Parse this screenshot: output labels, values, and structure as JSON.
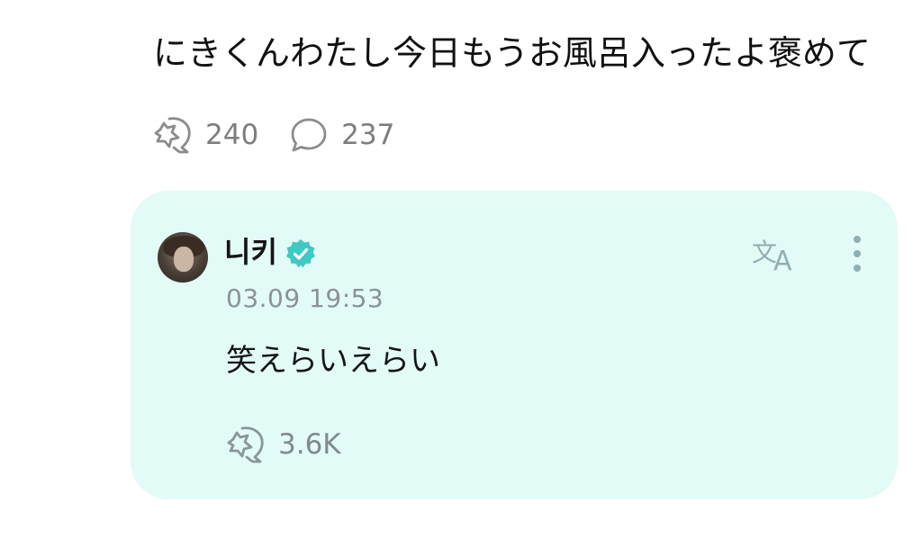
{
  "post": {
    "text": "にきくんわたし今日もうお風呂入ったよ褒めて",
    "like_count": "240",
    "comment_count": "237",
    "like_icon": "star-hand-icon",
    "comment_icon": "speech-bubble-icon"
  },
  "reply": {
    "author_name": "니키",
    "timestamp": "03.09 19:53",
    "text": "笑えらいえらい",
    "like_count": "3.6K",
    "verified_icon": "verified-badge-icon",
    "translate_icon": "translate-icon",
    "more_icon": "more-vertical-icon",
    "card_color": "#e3fbf7",
    "accent_color": "#3ec9c2"
  }
}
